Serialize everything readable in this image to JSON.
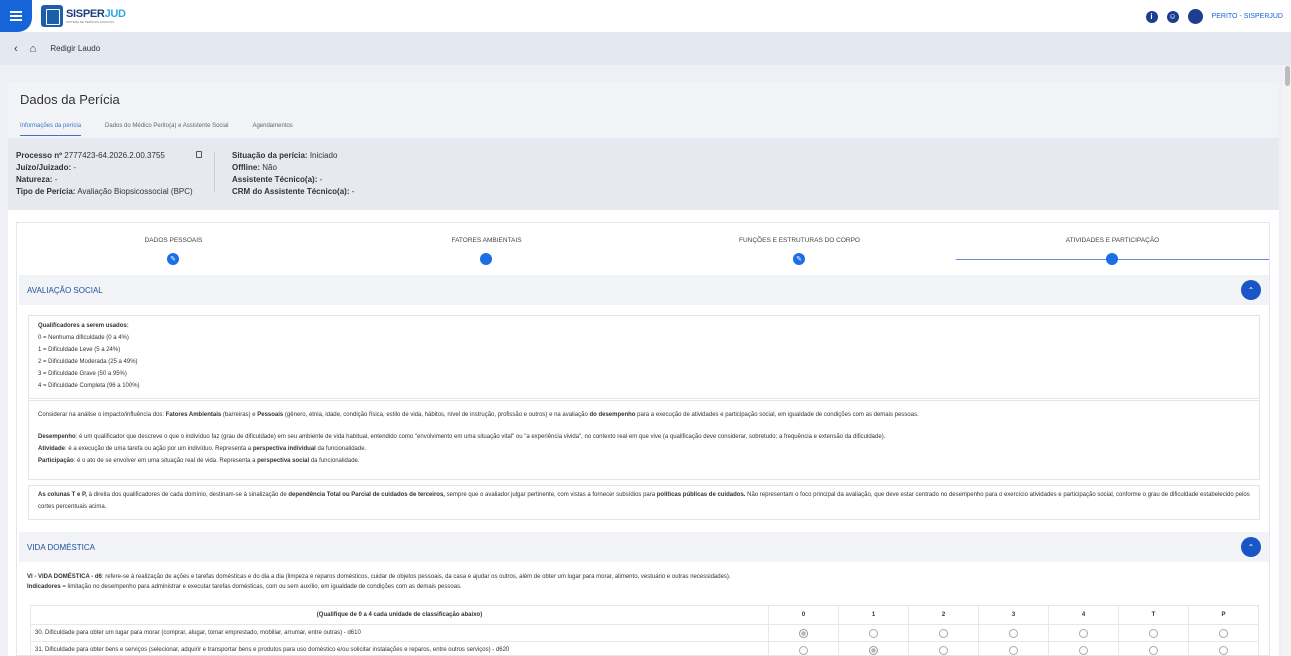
{
  "header": {
    "logo_text_a": "SISPER",
    "logo_text_b": "JUD",
    "logo_sub": "SISTEMA DE PERÍCIAS JUDICIAIS",
    "info_icon": "info-icon",
    "accessibility_icon": "accessibility-icon",
    "user_icon": "user-settings-icon",
    "user_label": "PERITO - SISPERJUD"
  },
  "breadcrumb": {
    "back_icon": "chevron-left-icon",
    "home_icon": "home-icon",
    "title": "Redigir Laudo"
  },
  "page": {
    "title": "Dados da Perícia",
    "tabs": [
      "Informações da perícia",
      "Dados do Médico Perito(a) e Assistente Social",
      "Agendamentos"
    ]
  },
  "process": {
    "l1_label": "Processo nº",
    "l1_value": "2777423-64.2026.2.00.3755",
    "l2_label": "Juízo/Juizado:",
    "l2_value": "-",
    "l3_label": "Natureza:",
    "l3_value": "-",
    "l4_label": "Tipo de Perícia:",
    "l4_value": "Avaliação Biopsicossocial (BPC)",
    "r1_label": "Situação da perícia:",
    "r1_value": "Iniciado",
    "r2_label": "Offline:",
    "r2_value": "Não",
    "r3_label": "Assistente Técnico(a):",
    "r3_value": "-",
    "r4_label": "CRM do Assistente Técnico(a):",
    "r4_value": "-"
  },
  "steps": [
    "DADOS PESSOAIS",
    "FATORES AMBIENTAIS",
    "FUNÇÕES E ESTRUTURAS DO CORPO",
    "ATIVIDADES E PARTICIPAÇÃO"
  ],
  "avaliacao": {
    "title": "AVALIAÇÃO SOCIAL",
    "qual_title": "Qualificadores a serem usados:",
    "q0": "0 = Nenhuma dificuldade (0 a 4%)",
    "q1": "1 = Dificuldade Leve (5 a 24%)",
    "q2": "2 = Dificuldade Moderada (25 a 49%)",
    "q3": "3 = Dificuldade Grave (50 a 95%)",
    "q4": "4 = Dificuldade Completa (96 a 100%)",
    "c1a": "Considerar na análise o impacto/influência dos: ",
    "c1b": "Fatores Ambientais",
    "c1c": " (barreiras) e ",
    "c1d": "Pessoais",
    "c1e": " (gênero, etnia, idade, condição física, estilo de vida, hábitos, nível de instrução, profissão e outros) e na avaliação ",
    "c1f": "do desempenho",
    "c1g": " para a execução de atividades e participação social, em igualdade de condições com as demais pessoas.",
    "d1a": "Desempenho",
    "d1b": ": é um qualificador que descreve o que o indivíduo faz (grau de dificuldade) em seu ambiente de vida habitual, entendido como \"envolvimento em uma situação vital\" ou \"a experiência vivida\", no contexto real em que vive (a qualificação deve considerar, sobretudo; a frequência e extensão da dificuldade).",
    "d2a": "Atividade",
    "d2b": ": é a execução de uma tarefa ou ação por um indivíduo. Representa a ",
    "d2c": "perspectiva individual",
    "d2d": " da funcionalidade.",
    "d3a": "Participação",
    "d3b": ": é o ato de se envolver em uma situação real de vida. Representa a ",
    "d3c": "perspectiva social",
    "d3d": " da funcionalidade.",
    "e1a": "As colunas T e P,",
    "e1b": " à direita dos qualificadores de cada domínio, destinam-se à sinalização de ",
    "e1c": "dependência Total ou Parcial de cuidados de terceiros,",
    "e1d": " sempre que o avaliador julgar pertinente, com vistas a fornecer subsídios para ",
    "e1e": "políticas públicas de cuidados.",
    "e1f": " Não representam o foco principal da avaliação, que deve estar centrado no desempenho para o exercício atividades e participação social, conforme o grau de dificuldade estabelecido pelos cortes percentuais acima."
  },
  "vida": {
    "title": "VIDA DOMÉSTICA",
    "p1a": "VI - VIDA DOMÉSTICA - d6",
    "p1b": ": refere-se à realização de ações e tarefas domésticas e do dia a dia (limpeza e reparos domésticos, cuidar de objetos pessoais, da casa e ajudar os outros, além de obter um lugar para morar, alimento, vestuário e outras necessidades).",
    "p2a": "Indicadores",
    "p2b": " = limitação no desempenho para administrar e executar tarefas domésticas, com ou sem auxílio, em igualdade de condições com as demais pessoas.",
    "table_head": "(Qualifique de 0 a 4 cada unidade de classificação abaixo)",
    "cols": [
      "0",
      "1",
      "2",
      "3",
      "4",
      "T",
      "P"
    ],
    "rows": [
      {
        "text": "30. Dificuldade para obter um lugar para morar (comprar, alugar, tomar emprestado, mobiliar, arrumar, entre outras) - d610",
        "selected": "0"
      },
      {
        "text": "31. Dificuldade para obter bens e serviços (selecionar, adquirir e transportar bens e produtos para uso doméstico e/ou solicitar instalações e reparos, entre outros serviços) - d620",
        "selected": "1"
      }
    ]
  }
}
